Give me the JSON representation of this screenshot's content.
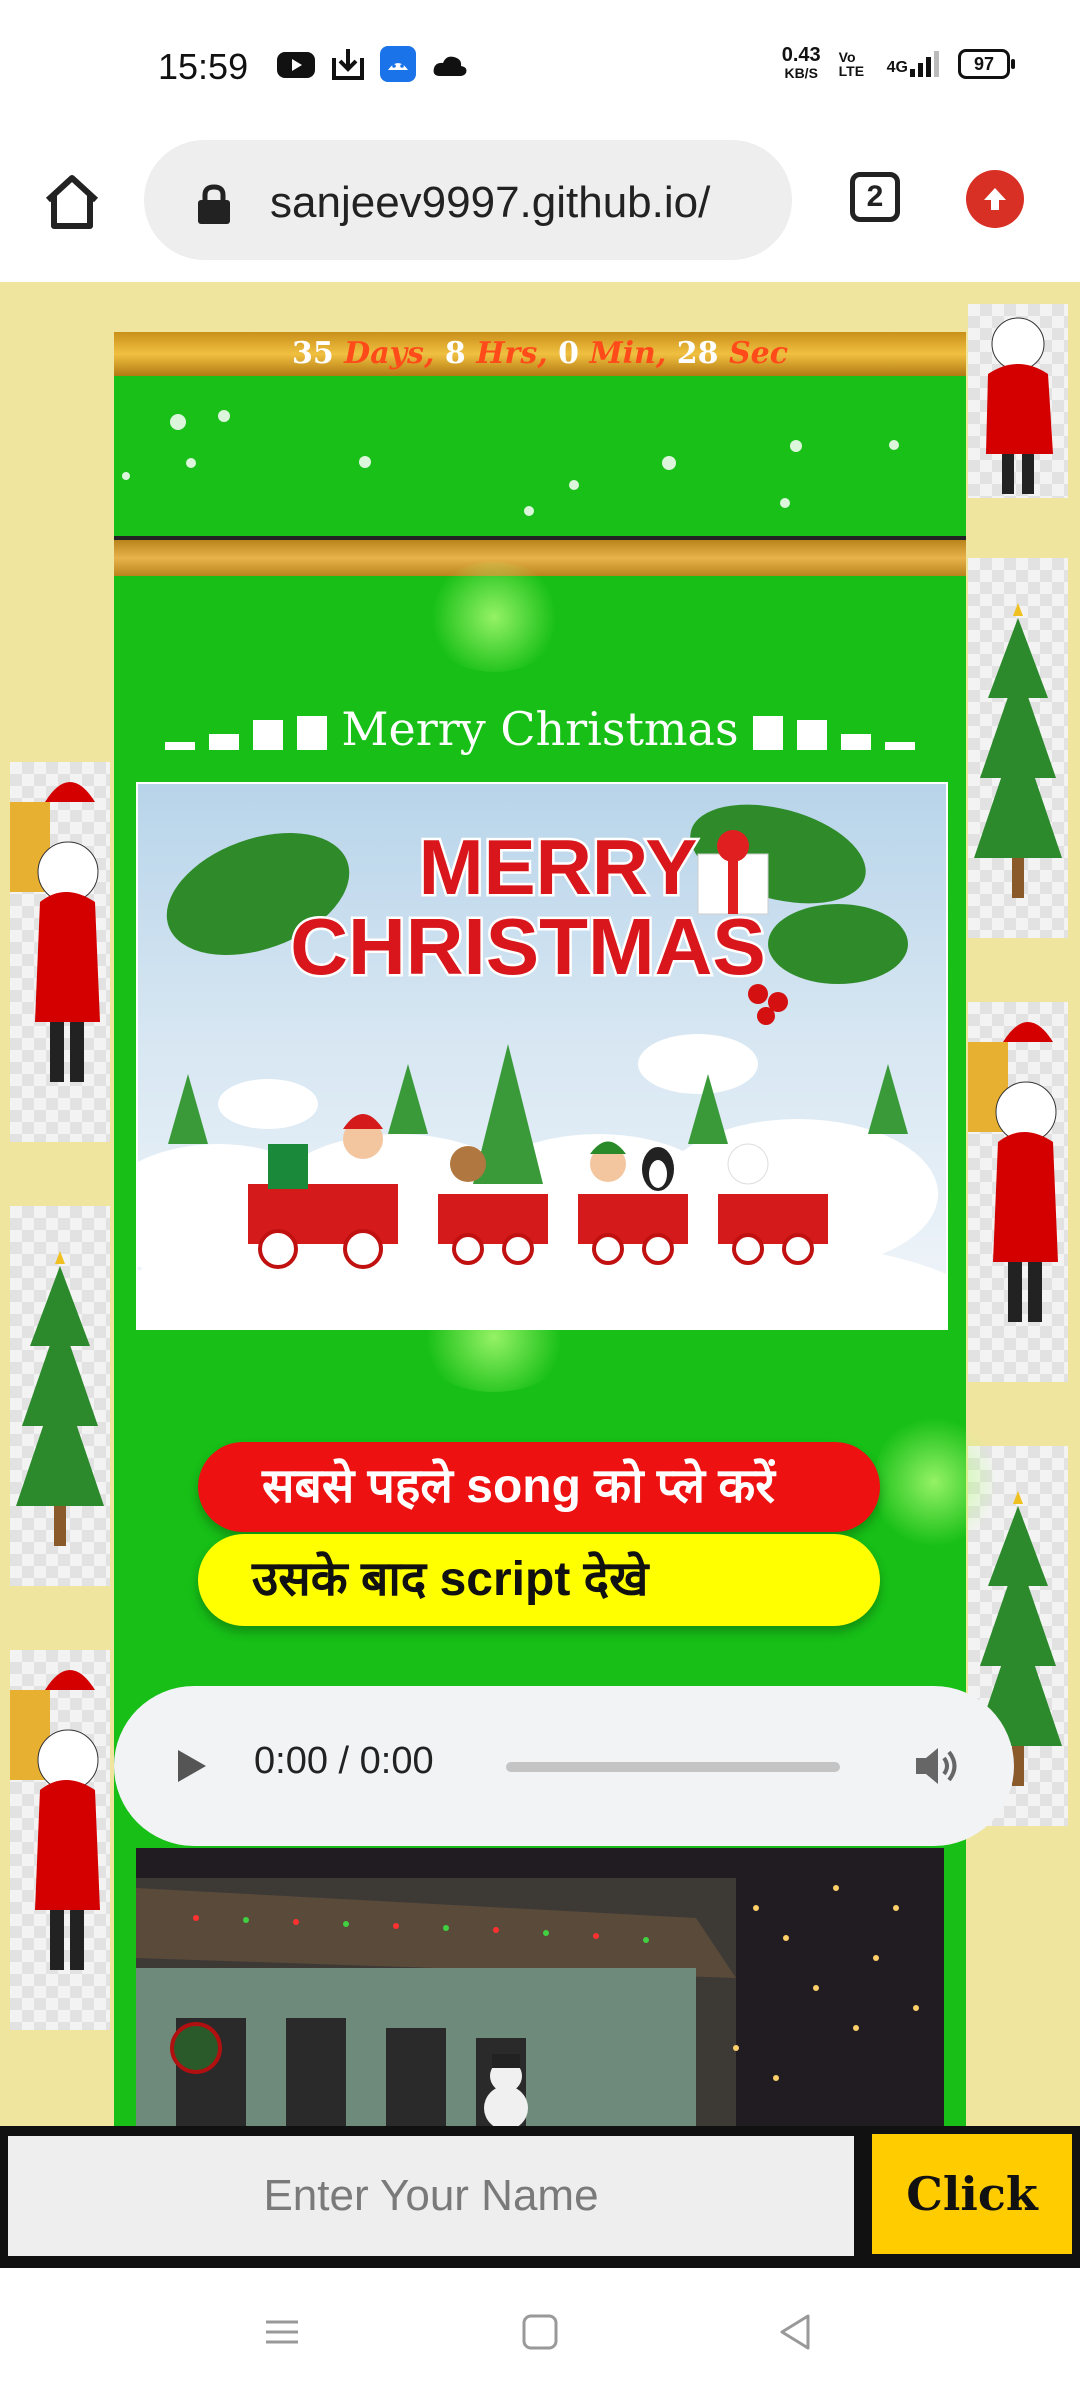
{
  "status_bar": {
    "time": "15:59",
    "net_speed_value": "0.43",
    "net_speed_unit": "KB/S",
    "volte": "Vo LTE",
    "network": "4G",
    "battery": "97",
    "icons": [
      "youtube-icon",
      "download-icon",
      "android-icon",
      "cloud-icon",
      "signal-icon"
    ]
  },
  "browser": {
    "url": "sanjeev9997.github.io/",
    "tab_count": "2",
    "icons": [
      "home-icon",
      "lock-icon",
      "tabs-icon",
      "update-icon"
    ]
  },
  "countdown": {
    "days": "35",
    "days_label": "Days,",
    "hrs": "8",
    "hrs_label": "Hrs,",
    "min": "0",
    "min_label": "Min,",
    "sec": "28",
    "sec_label": "Sec"
  },
  "heading": "Merry Christmas",
  "banner": {
    "line1": "MERRY",
    "line2": "CHRISTMAS"
  },
  "buttons": {
    "play_song": "सबसे पहले song को प्ले करें",
    "see_script": "उसके बाद script देखे"
  },
  "audio": {
    "time": "0:00 / 0:00",
    "progress": 0
  },
  "form": {
    "name_placeholder": "Enter Your Name",
    "click_label": "Click"
  },
  "colors": {
    "page_bg": "#efe59f",
    "main_green": "#17bf17",
    "red_button": "#ee1111",
    "yellow_button": "#ffff00",
    "click_button": "#ffcc00",
    "countdown_unit": "#ff4a1a"
  }
}
